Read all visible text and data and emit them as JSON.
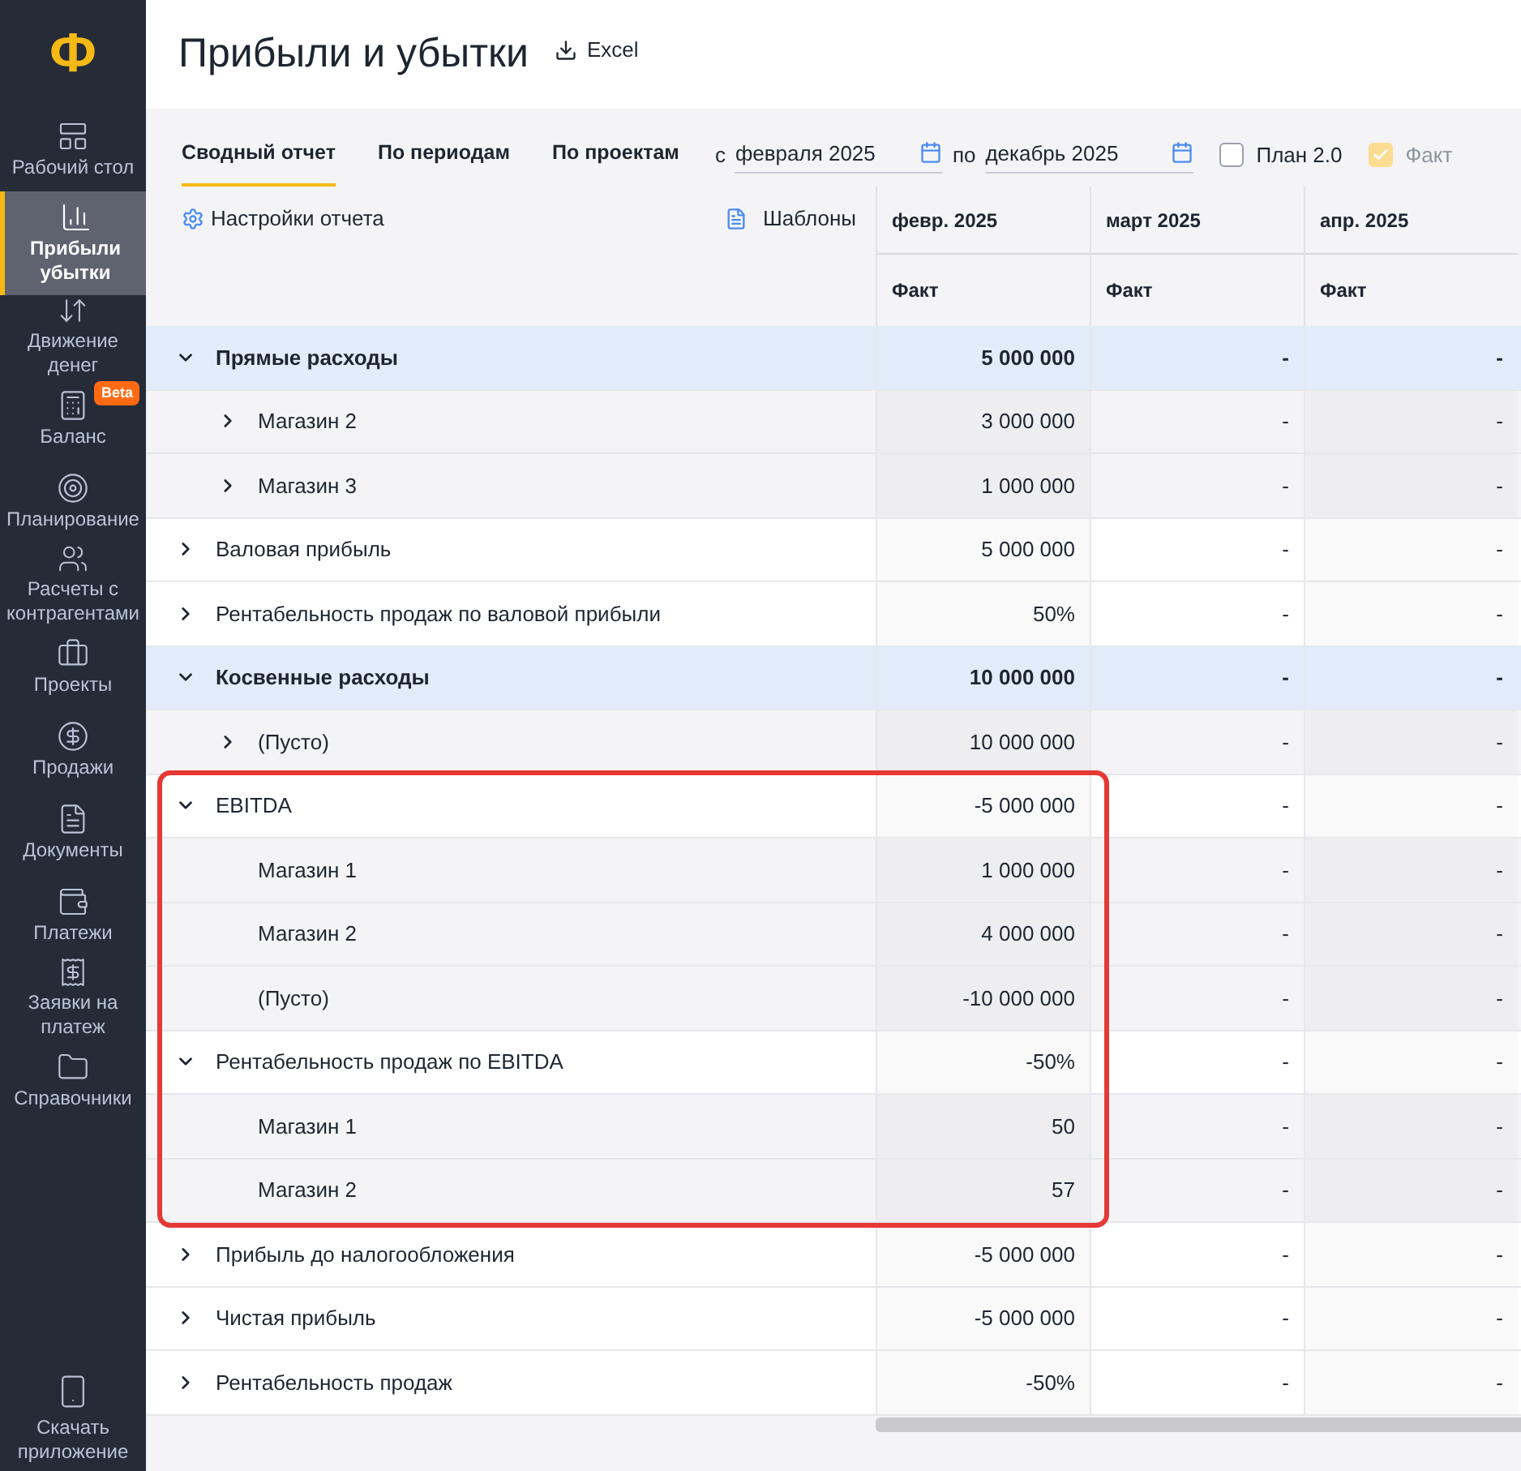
{
  "logo": "Ф",
  "sidebar": {
    "items": [
      {
        "label": "Рабочий стол",
        "selected": false
      },
      {
        "label": "Прибыли убытки",
        "selected": true
      },
      {
        "label": "Движение денег",
        "selected": false
      },
      {
        "label": "Баланс",
        "selected": false,
        "badge": "Beta"
      },
      {
        "label": "Планирование",
        "selected": false
      },
      {
        "label": "Расчеты с контрагентами",
        "selected": false
      },
      {
        "label": "Проекты",
        "selected": false
      },
      {
        "label": "Продажи",
        "selected": false
      },
      {
        "label": "Документы",
        "selected": false
      },
      {
        "label": "Платежи",
        "selected": false
      },
      {
        "label": "Заявки на платеж",
        "selected": false
      },
      {
        "label": "Справочники",
        "selected": false
      }
    ],
    "footer": "Скачать приложение"
  },
  "page": {
    "title": "Прибыли и убытки",
    "export": "Excel"
  },
  "tabs": [
    {
      "label": "Сводный отчет",
      "selected": true
    },
    {
      "label": "По периодам",
      "selected": false
    },
    {
      "label": "По проектам",
      "selected": false
    }
  ],
  "period": {
    "from_label": "с",
    "from": "февраля 2025",
    "to_label": "по",
    "to": "декабрь 2025"
  },
  "toggles": [
    {
      "label": "План 2.0",
      "checked": false
    },
    {
      "label": "Факт",
      "checked": true,
      "disabled": true
    }
  ],
  "report_settings": "Настройки отчета",
  "templates": "Шаблоны",
  "table": {
    "columns": [
      {
        "period": "февр. 2025",
        "measure": "Факт"
      },
      {
        "period": "март 2025",
        "measure": "Факт"
      },
      {
        "period": "апр. 2025",
        "measure": "Факт"
      }
    ],
    "rows": [
      {
        "kind": "group",
        "label": "Прямые расходы",
        "expanded": true,
        "values": [
          "5 000 000",
          "-",
          "-"
        ]
      },
      {
        "kind": "child",
        "label": "Магазин 2",
        "expanded": false,
        "values": [
          "3 000 000",
          "-",
          "-"
        ]
      },
      {
        "kind": "child",
        "label": "Магазин 3",
        "expanded": false,
        "values": [
          "1 000 000",
          "-",
          "-"
        ]
      },
      {
        "kind": "item",
        "label": "Валовая прибыль",
        "expanded": false,
        "values": [
          "5 000 000",
          "-",
          "-"
        ]
      },
      {
        "kind": "item",
        "label": "Рентабельность продаж по валовой прибыли",
        "expanded": false,
        "values": [
          "50%",
          "-",
          "-"
        ]
      },
      {
        "kind": "group",
        "label": "Косвенные расходы",
        "expanded": true,
        "values": [
          "10 000 000",
          "-",
          "-"
        ]
      },
      {
        "kind": "child",
        "label": "(Пусто)",
        "expanded": false,
        "values": [
          "10 000 000",
          "-",
          "-"
        ]
      },
      {
        "kind": "item",
        "label": "EBITDA",
        "expanded": true,
        "highlight": true,
        "values": [
          "-5 000 000",
          "-",
          "-"
        ]
      },
      {
        "kind": "child",
        "label": "Магазин 1",
        "highlight": true,
        "values": [
          "1 000 000",
          "-",
          "-"
        ]
      },
      {
        "kind": "child",
        "label": "Магазин 2",
        "highlight": true,
        "values": [
          "4 000 000",
          "-",
          "-"
        ]
      },
      {
        "kind": "child",
        "label": "(Пусто)",
        "highlight": true,
        "values": [
          "-10 000 000",
          "-",
          "-"
        ]
      },
      {
        "kind": "item",
        "label": "Рентабельность продаж по EBITDA",
        "expanded": true,
        "highlight": true,
        "values": [
          "-50%",
          "-",
          "-"
        ]
      },
      {
        "kind": "child",
        "label": "Магазин 1",
        "highlight": true,
        "values": [
          "50",
          "-",
          "-"
        ]
      },
      {
        "kind": "child",
        "label": "Магазин 2",
        "highlight": true,
        "values": [
          "57",
          "-",
          "-"
        ]
      },
      {
        "kind": "item",
        "label": "Прибыль до налогообложения",
        "expanded": false,
        "values": [
          "-5 000 000",
          "-",
          "-"
        ]
      },
      {
        "kind": "item",
        "label": "Чистая прибыль",
        "expanded": false,
        "values": [
          "-5 000 000",
          "-",
          "-"
        ]
      },
      {
        "kind": "item",
        "label": "Рентабельность продаж",
        "expanded": false,
        "values": [
          "-50%",
          "-",
          "-"
        ]
      }
    ]
  }
}
